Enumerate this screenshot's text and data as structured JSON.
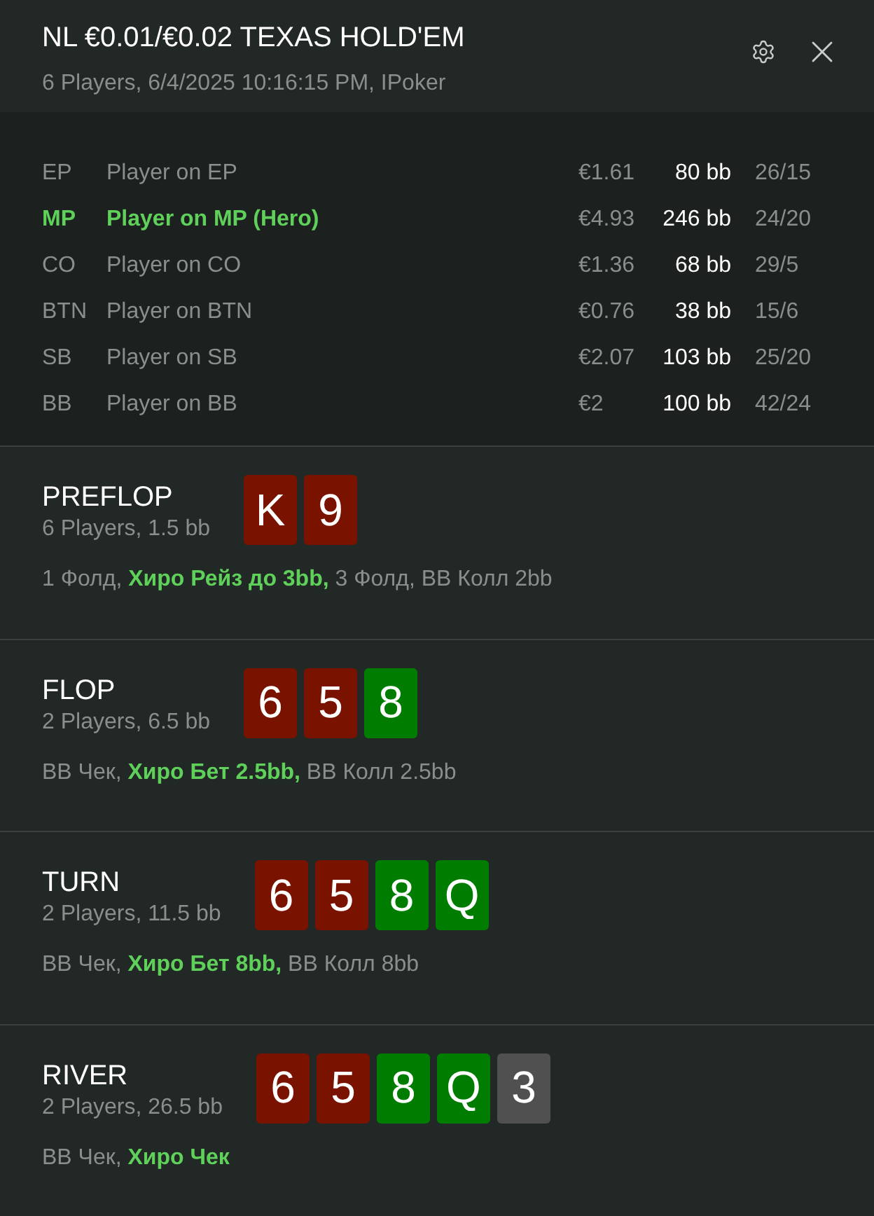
{
  "header": {
    "title": "NL €0.01/€0.02 TEXAS HOLD'EM",
    "subtitle": "6 Players, 6/4/2025 10:16:15 PM, IPoker"
  },
  "players": [
    {
      "position": "EP",
      "name": "Player on EP",
      "stack": "€1.61",
      "bb": "80 bb",
      "stats": "26/15",
      "hero": false
    },
    {
      "position": "MP",
      "name": "Player on MP (Hero)",
      "stack": "€4.93",
      "bb": "246 bb",
      "stats": "24/20",
      "hero": true
    },
    {
      "position": "CO",
      "name": "Player on CO",
      "stack": "€1.36",
      "bb": "68 bb",
      "stats": "29/5",
      "hero": false
    },
    {
      "position": "BTN",
      "name": "Player on BTN",
      "stack": "€0.76",
      "bb": "38 bb",
      "stats": "15/6",
      "hero": false
    },
    {
      "position": "SB",
      "name": "Player on SB",
      "stack": "€2.07",
      "bb": "103 bb",
      "stats": "25/20",
      "hero": false
    },
    {
      "position": "BB",
      "name": "Player on BB",
      "stack": "€2",
      "bb": "100 bb",
      "stats": "42/24",
      "hero": false
    }
  ],
  "streets": [
    {
      "name": "PREFLOP",
      "info": "6 Players, 1.5 bb",
      "cards": [
        {
          "rank": "K",
          "color": "#7a1200"
        },
        {
          "rank": "9",
          "color": "#7a1200"
        }
      ],
      "actions": "1 Фолд, **Хиро Рейз до 3bb,** 3 Фолд, BB Колл 2bb"
    },
    {
      "name": "FLOP",
      "info": "2 Players, 6.5 bb",
      "cards": [
        {
          "rank": "6",
          "color": "#7a1200"
        },
        {
          "rank": "5",
          "color": "#7a1200"
        },
        {
          "rank": "8",
          "color": "#007c00"
        }
      ],
      "actions": "BB Чек, **Хиро Бет 2.5bb,** BB Колл 2.5bb"
    },
    {
      "name": "TURN",
      "info": "2 Players, 11.5 bb",
      "cards": [
        {
          "rank": "6",
          "color": "#7a1200"
        },
        {
          "rank": "5",
          "color": "#7a1200"
        },
        {
          "rank": "8",
          "color": "#007c00"
        },
        {
          "rank": "Q",
          "color": "#007c00"
        }
      ],
      "actions": "BB Чек, **Хиро Бет 8bb,** BB Колл 8bb"
    },
    {
      "name": "RIVER",
      "info": "2 Players, 26.5 bb",
      "cards": [
        {
          "rank": "6",
          "color": "#7a1200"
        },
        {
          "rank": "5",
          "color": "#7a1200"
        },
        {
          "rank": "8",
          "color": "#007c00"
        },
        {
          "rank": "Q",
          "color": "#007c00"
        },
        {
          "rank": "3",
          "color": "#505050"
        }
      ],
      "actions": "BB Чек, **Хиро Чек**"
    }
  ]
}
